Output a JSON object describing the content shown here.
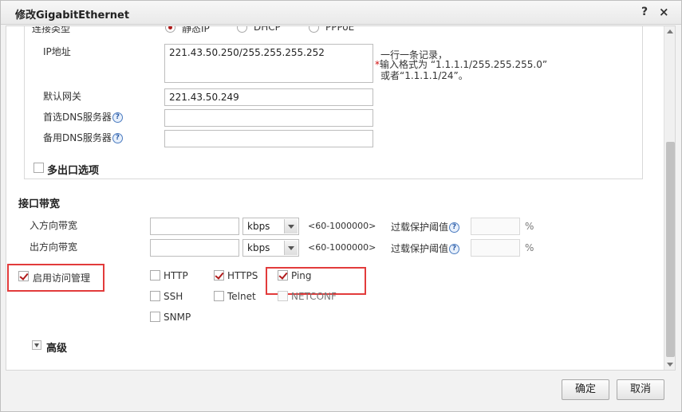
{
  "window": {
    "title": "修改GigabitEthernet",
    "help": "?",
    "close": "×"
  },
  "connection": {
    "label": "连接类型",
    "options": [
      "静态IP",
      "DHCP",
      "PPPoE"
    ],
    "selected": "静态IP"
  },
  "ip": {
    "label": "IP地址",
    "value": "221.43.50.250/255.255.255.252",
    "note_line1": "一行一条记录，",
    "note_star": "*",
    "note_line2": "输入格式为 “1.1.1.1/255.255.255.0”",
    "note_line3": "或者“1.1.1.1/24”。"
  },
  "gateway": {
    "label": "默认网关",
    "value": "221.43.50.249"
  },
  "dns1": {
    "label": "首选DNS服务器",
    "value": ""
  },
  "dns2": {
    "label": "备用DNS服务器",
    "value": ""
  },
  "multi_exit": {
    "label": "多出口选项",
    "checked": false
  },
  "bandwidth": {
    "title": "接口带宽",
    "inbound": {
      "label": "入方向带宽",
      "value": "",
      "unit": "kbps",
      "range": "<60-1000000>",
      "threshold_label": "过载保护阈值",
      "percent": "%"
    },
    "outbound": {
      "label": "出方向带宽",
      "value": "",
      "unit": "kbps",
      "range": "<60-1000000>",
      "threshold_label": "过载保护阈值",
      "percent": "%"
    }
  },
  "access": {
    "label": "启用访问管理",
    "enabled": true,
    "services": [
      {
        "name": "HTTP",
        "checked": false
      },
      {
        "name": "HTTPS",
        "checked": true
      },
      {
        "name": "Ping",
        "checked": true
      },
      {
        "name": "SSH",
        "checked": false
      },
      {
        "name": "Telnet",
        "checked": false
      },
      {
        "name": "NETCONF",
        "checked": false
      },
      {
        "name": "SNMP",
        "checked": false
      }
    ]
  },
  "advanced": {
    "label": "高级"
  },
  "footer": {
    "ok": "确定",
    "cancel": "取消"
  },
  "icons": {
    "help": "help-icon",
    "close": "close-icon"
  },
  "colors": {
    "accent_red": "#e23b3b",
    "check_red": "#b01b1b"
  }
}
